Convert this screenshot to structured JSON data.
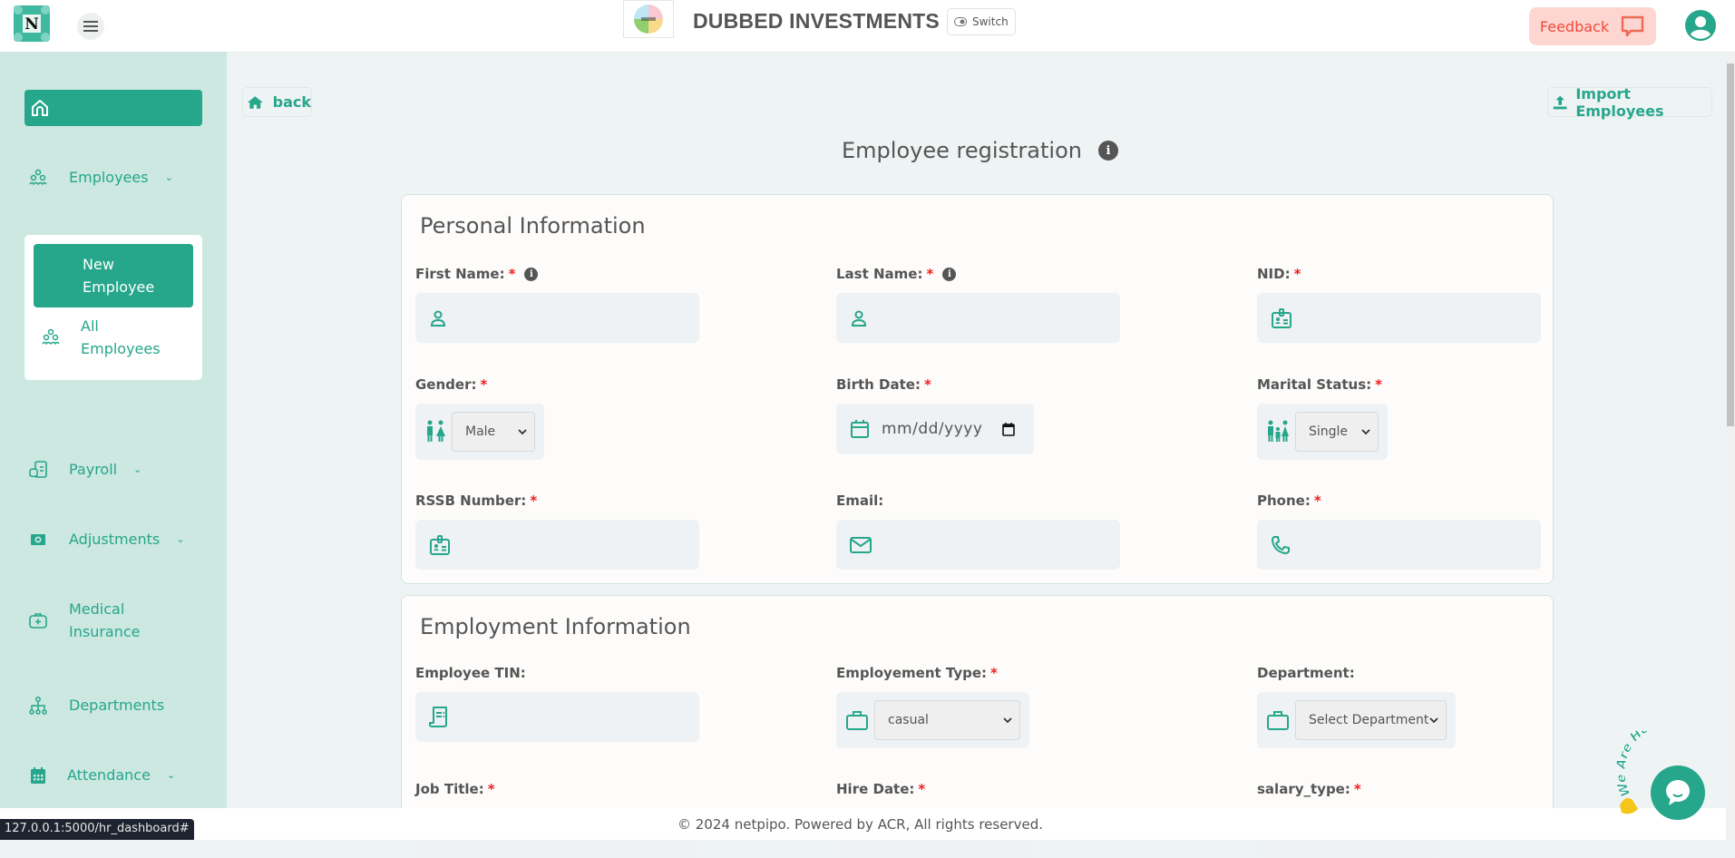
{
  "header": {
    "company_name": "DUBBED INVESTMENTS",
    "switch_label": "Switch",
    "feedback_label": "Feedback"
  },
  "sidebar": {
    "items": [
      {
        "label": "Employees",
        "icon": "people-icon",
        "expandable": true
      },
      {
        "label": "Payroll",
        "icon": "payroll-icon",
        "expandable": true
      },
      {
        "label": "Adjustments",
        "icon": "money-icon",
        "expandable": true
      },
      {
        "label": "Medical Insurance",
        "icon": "medical-case-icon",
        "expandable": false
      },
      {
        "label": "Departments",
        "icon": "org-chart-icon",
        "expandable": false
      },
      {
        "label": "Attendance",
        "icon": "calendar-icon",
        "expandable": true
      }
    ],
    "submenu": {
      "active": "New Employee",
      "other": "All Employees"
    }
  },
  "toolbar": {
    "back_label": "back",
    "import_label": "Import Employees"
  },
  "page": {
    "title": "Employee registration"
  },
  "personal": {
    "title": "Personal Information",
    "fields": {
      "first_name": {
        "label": "First Name:",
        "required": "*",
        "value": ""
      },
      "last_name": {
        "label": "Last Name:",
        "required": "*",
        "value": ""
      },
      "nid": {
        "label": "NID:",
        "required": "*",
        "value": ""
      },
      "gender": {
        "label": "Gender:",
        "required": "*",
        "selected": "Male"
      },
      "birth_date": {
        "label": "Birth Date:",
        "required": "*",
        "placeholder": "mm/dd/yyyy"
      },
      "marital": {
        "label": "Marital Status:",
        "required": "*",
        "selected": "Single"
      },
      "rssb": {
        "label": "RSSB Number:",
        "required": "*",
        "value": ""
      },
      "email": {
        "label": "Email:",
        "value": ""
      },
      "phone": {
        "label": "Phone:",
        "required": "*",
        "value": ""
      }
    }
  },
  "employment": {
    "title": "Employment Information",
    "fields": {
      "tin": {
        "label": "Employee TIN:",
        "value": ""
      },
      "type": {
        "label": "Employement Type:",
        "required": "*",
        "selected": "casual"
      },
      "department": {
        "label": "Department:",
        "selected": "Select Department"
      },
      "job_title": {
        "label": "Job Title:",
        "required": "*"
      },
      "hire_date": {
        "label": "Hire Date:",
        "required": "*"
      },
      "salary_type": {
        "label": "salary_type:",
        "required": "*"
      }
    }
  },
  "footer": {
    "text": "© 2024 netpipo. Powered by ACR, All rights reserved."
  },
  "status_bar": {
    "url": "127.0.0.1:5000/hr_dashboard#"
  },
  "chat": {
    "tagline": "We Are Here!"
  },
  "colors": {
    "brand": "#26a68b",
    "sidebar_bg": "#cce8e1",
    "feedback_bg": "#fdd6d2",
    "feedback_text": "#f04b3a",
    "required": "#f01f1f"
  }
}
